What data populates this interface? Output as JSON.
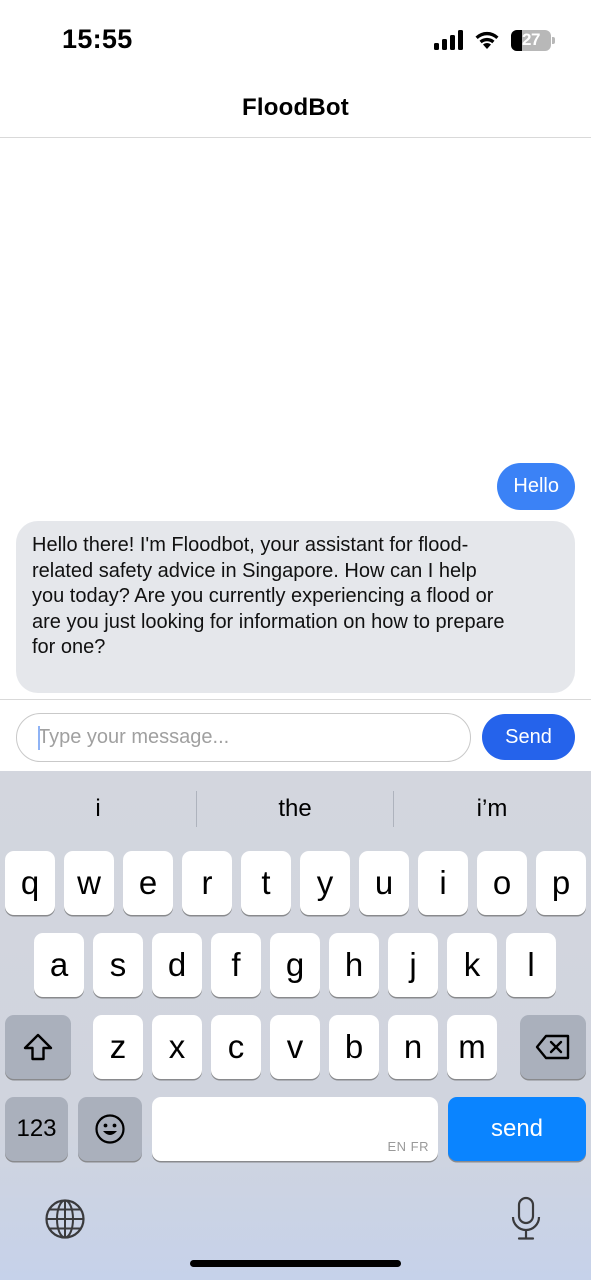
{
  "status_bar": {
    "time": "15:55",
    "battery": "27",
    "battery_level": 0.27
  },
  "header": {
    "title": "FloodBot"
  },
  "messages": [
    {
      "role": "user",
      "text": "Hello"
    },
    {
      "role": "bot",
      "text": "Hello there! I'm Floodbot, your assistant for flood-related safety advice in Singapore. How can I help you today? Are you currently experiencing a flood or are you just looking for information on how to prepare for one?"
    }
  ],
  "bot_lines": [
    "Hello there! I'm Floodbot, your assistant for flood-",
    "related safety advice in Singapore. How can I help",
    "you today? Are you currently experiencing a flood or",
    "are you just looking for information on how to prepare",
    "for one?"
  ],
  "composer": {
    "placeholder": "Type your message...",
    "value": "",
    "send_label": "Send"
  },
  "keyboard": {
    "suggestions": [
      "i",
      "the",
      "i’m"
    ],
    "row1": [
      "q",
      "w",
      "e",
      "r",
      "t",
      "y",
      "u",
      "i",
      "o",
      "p"
    ],
    "row2": [
      "a",
      "s",
      "d",
      "f",
      "g",
      "h",
      "j",
      "k",
      "l"
    ],
    "row3": [
      "z",
      "x",
      "c",
      "v",
      "b",
      "n",
      "m"
    ],
    "numbers_label": "123",
    "language_hint": "EN FR",
    "send_label": "send",
    "send_color": "#0a84ff"
  },
  "colors": {
    "user_bubble": "#3b82f6",
    "bot_bubble": "#e5e7eb",
    "send_button": "#2563eb"
  }
}
